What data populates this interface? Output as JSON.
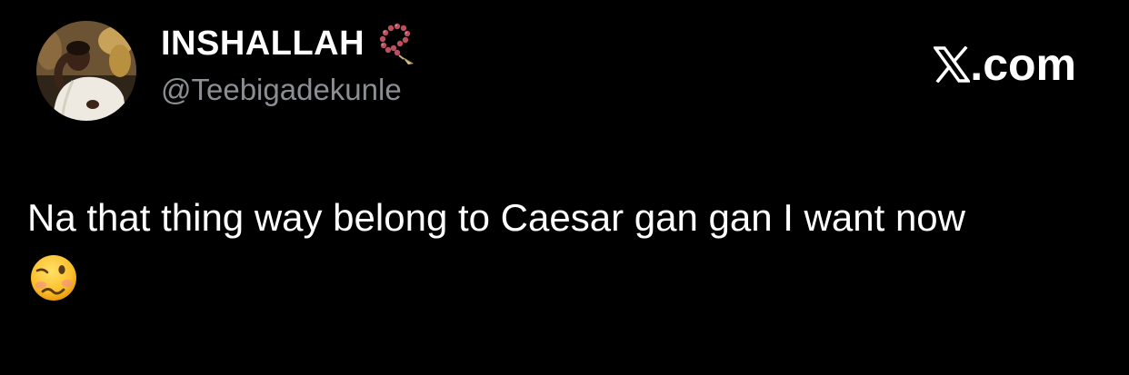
{
  "author": {
    "display_name": "INSHALLAH",
    "handle": "@Teebigadekunle",
    "avatar_icon": "profile-photo",
    "name_badge_icon": "prayer-beads-icon"
  },
  "brand": {
    "logo_icon": "x-logo-icon",
    "text": ".com"
  },
  "tweet": {
    "text": "Na that thing way belong to Caesar gan gan I want now",
    "emoji": "🥴",
    "emoji_icon": "woozy-face-icon"
  },
  "colors": {
    "background": "#000000",
    "primary_text": "#ffffff",
    "secondary_text": "#8b8e92"
  }
}
